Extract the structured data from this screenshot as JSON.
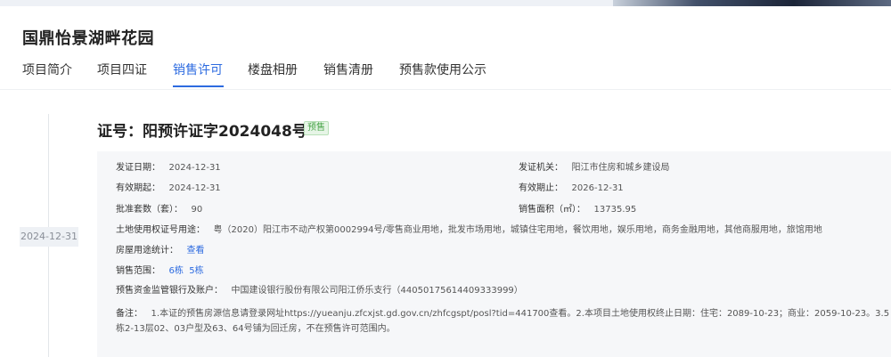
{
  "project": {
    "title": "国鼎怡景湖畔花园"
  },
  "tabs": [
    {
      "label": "项目简介"
    },
    {
      "label": "项目四证"
    },
    {
      "label": "销售许可"
    },
    {
      "label": "楼盘相册"
    },
    {
      "label": "销售清册"
    },
    {
      "label": "预售款使用公示"
    }
  ],
  "active_tab": "销售许可",
  "timeline": {
    "date": "2024-12-31"
  },
  "certificate": {
    "heading": "证号：阳预许证字2024048号",
    "badge": "预售",
    "issue_date_label": "发证日期：",
    "issue_date": "2024-12-31",
    "issuer_label": "发证机关：",
    "issuer": "阳江市住房和城乡建设局",
    "valid_from_label": "有效期起：",
    "valid_from": "2024-12-31",
    "valid_to_label": "有效期止：",
    "valid_to": "2026-12-31",
    "units_label": "批准套数（套）：",
    "units": "90",
    "area_label": "销售面积（㎡）：",
    "area": "13735.95",
    "land_use_label": "土地使用权证号用途：",
    "land_use": "粤（2020）阳江市不动产权第0002994号/零售商业用地，批发市场用地，城镇住宅用地，餐饮用地，娱乐用地，商务金融用地，其他商服用地，旅馆用地",
    "house_use_label": "房屋用途统计：",
    "house_use_link": "查看",
    "sale_range_label": "销售范围：",
    "sale_range": [
      "6栋",
      "5栋"
    ],
    "bank_label": "预售资金监管银行及账户：",
    "bank": "中国建设银行股份有限公司阳江侨乐支行（44050175614409333999）",
    "note_label": "备注：",
    "note": "1.本证的预售房源信息请登录网址https://yueanju.zfcxjst.gd.gov.cn/zhfcgspt/posl?tid=441700查看。2.本项目土地使用权终止日期：住宅：2089-10-23；商业：2059-10-23。3.5栋2-13层02、03户型及63、64号铺为回迁房，不在预售许可范围内。"
  }
}
